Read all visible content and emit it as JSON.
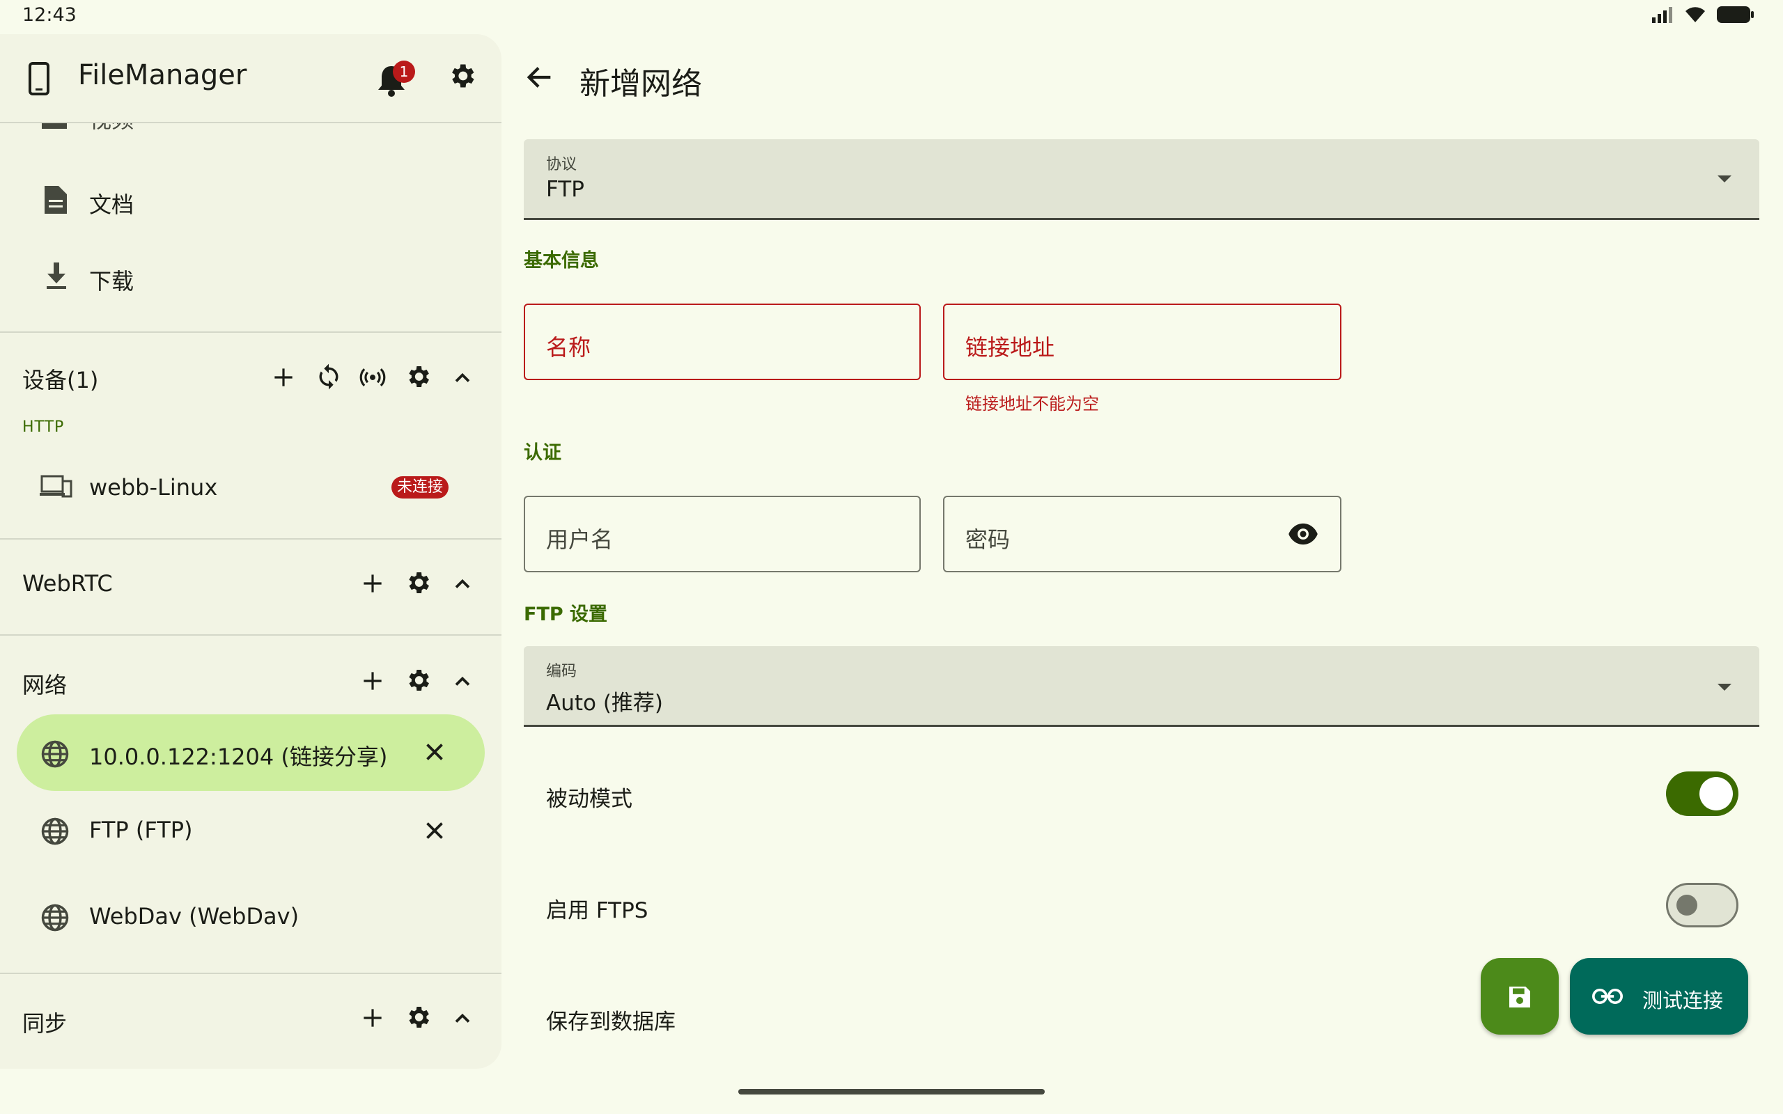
{
  "status_bar": {
    "time": "12:43"
  },
  "app": {
    "title": "FileManager",
    "notification_count": "1"
  },
  "drawer": {
    "partial_item": "视频",
    "items": [
      {
        "label": "文档",
        "icon": "document-icon"
      },
      {
        "label": "下载",
        "icon": "download-icon"
      }
    ],
    "devices": {
      "header": "设备(1)",
      "subheader": "HTTP",
      "item_label": "webb-Linux",
      "item_badge": "未连接"
    },
    "webrtc": {
      "header": "WebRTC"
    },
    "network": {
      "header": "网络",
      "items": [
        {
          "label": "10.0.0.122:1204 (链接分享)",
          "selected": true
        },
        {
          "label": "FTP (FTP)",
          "selected": false
        },
        {
          "label": "WebDav (WebDav)",
          "selected": false
        }
      ]
    },
    "sync": {
      "header": "同步"
    }
  },
  "page": {
    "title": "新增网络",
    "protocol": {
      "label": "协议",
      "value": "FTP"
    },
    "basic_section": "基本信息",
    "name_placeholder": "名称",
    "url_placeholder": "链接地址",
    "url_error": "链接地址不能为空",
    "auth_section": "认证",
    "username_placeholder": "用户名",
    "password_placeholder": "密码",
    "ftp_section": "FTP 设置",
    "encoding": {
      "label": "编码",
      "value": "Auto (推荐)"
    },
    "passive_mode": {
      "label": "被动模式",
      "on": true
    },
    "ftps": {
      "label": "启用 FTPS",
      "on": false
    },
    "save_db": {
      "label": "保存到数据库"
    },
    "test_button": "测试连接"
  },
  "colors": {
    "accent": "#3b6a00",
    "selected_bg": "#cdee9e",
    "error": "#ba1a1a",
    "fab_save": "#4c8a1a",
    "fab_test": "#006a5a"
  }
}
